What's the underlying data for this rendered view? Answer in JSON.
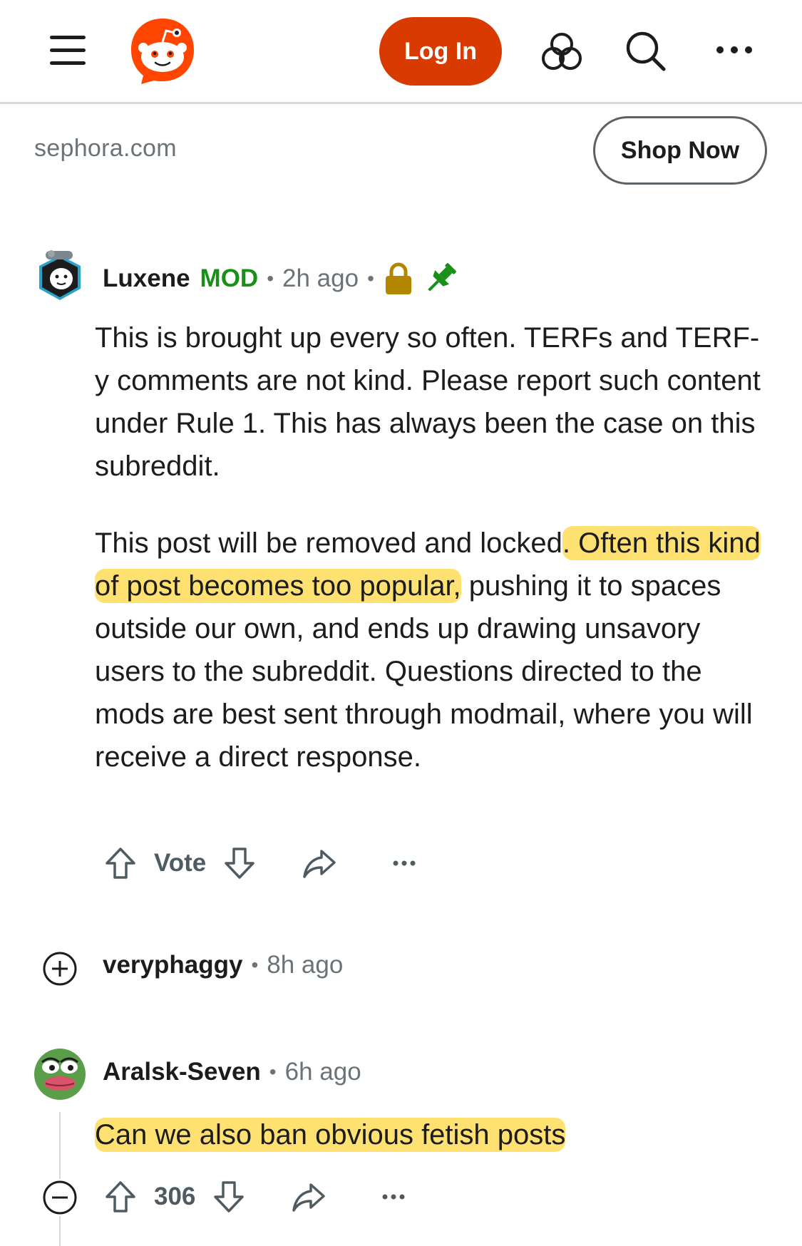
{
  "header": {
    "login_label": "Log In"
  },
  "ad": {
    "domain": "sephora.com",
    "cta_label": "Shop Now"
  },
  "comments": [
    {
      "username": "Luxene",
      "badge": "MOD",
      "time": "2h ago",
      "locked": true,
      "pinned": true,
      "paragraphs": [
        {
          "text": "This is brought up every so often. TERFs and TERF-y comments are not kind. Please report such content under Rule 1. This has always been the case on this subreddit."
        },
        {
          "before": "This post will be removed and locked",
          "highlight": ". Often this kind of post becomes too popular,",
          "after": " pushing it to spaces outside our own, and ends up drawing unsavory users to the subreddit. Questions directed to the mods are best sent through modmail, where you will receive a direct response."
        }
      ],
      "vote_label": "Vote"
    },
    {
      "username": "veryphaggy",
      "time": "8h ago",
      "collapsed": true
    },
    {
      "username": "Aralsk-Seven",
      "time": "6h ago",
      "highlight_text": "Can we also ban obvious fetish posts",
      "score": "306"
    }
  ],
  "colors": {
    "brand_orange": "#d93a00",
    "mod_green": "#1a8f1a",
    "highlight_yellow": "#ffd63c",
    "lock_gold": "#b38600",
    "muted_text": "#6a7378"
  }
}
